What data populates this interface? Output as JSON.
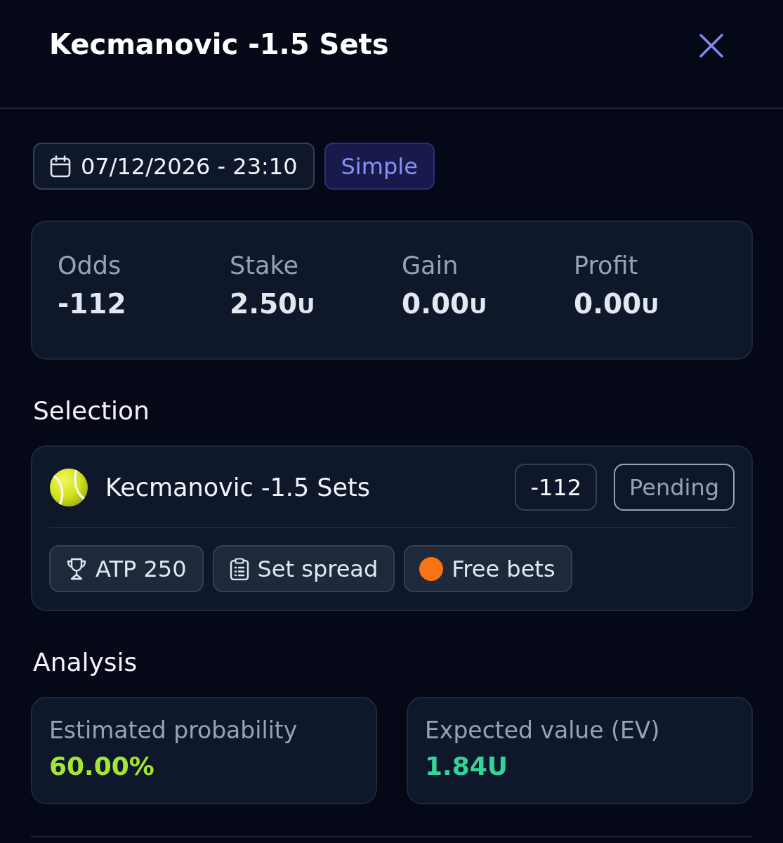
{
  "header": {
    "title": "Kecmanovic -1.5 Sets"
  },
  "meta": {
    "date": "07/12/2026 - 23:10",
    "bet_type": "Simple"
  },
  "stats": [
    {
      "label": "Odds",
      "value": "-112"
    },
    {
      "label": "Stake",
      "value": "2.50",
      "unit": "U"
    },
    {
      "label": "Gain",
      "value": "0.00",
      "unit": "U"
    },
    {
      "label": "Profit",
      "value": "0.00",
      "unit": "U"
    }
  ],
  "selection": {
    "heading": "Selection",
    "name": "Kecmanovic -1.5 Sets",
    "odds": "-112",
    "status": "Pending",
    "tags": [
      {
        "kind": "trophy",
        "label": "ATP 250"
      },
      {
        "kind": "clipboard",
        "label": "Set spread"
      },
      {
        "kind": "dot",
        "label": "Free bets",
        "color": "#f97316"
      }
    ]
  },
  "analysis": {
    "heading": "Analysis",
    "cards": [
      {
        "label": "Estimated probability",
        "value": "60.00%",
        "color": "#a3e635"
      },
      {
        "label": "Expected value (EV)",
        "value": "1.84U",
        "color": "#34d399"
      }
    ]
  }
}
